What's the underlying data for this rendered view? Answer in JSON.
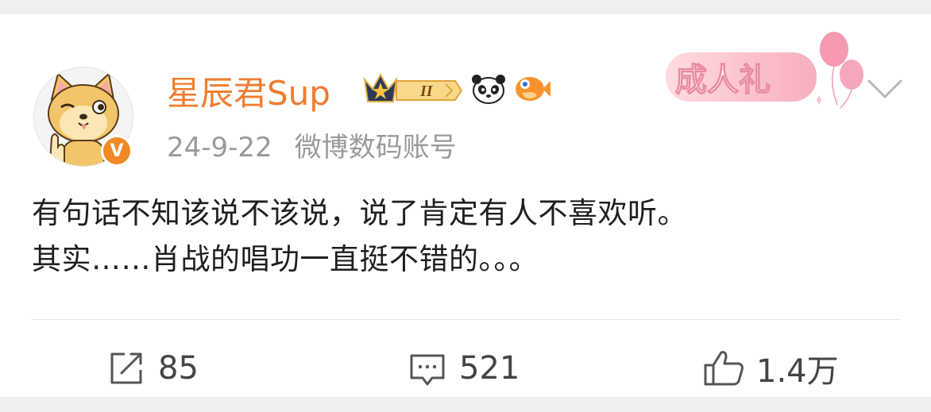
{
  "post": {
    "author": "星辰君Sup",
    "badge_level": "II",
    "date": "24-9-22",
    "account_type": "微博数码账号",
    "ceremony_badge": "成人礼",
    "text_lines": [
      "有句话不知该说不该说，说了肯定有人不喜欢听。",
      "其实……肖战的唱功一直挺不错的。。。"
    ]
  },
  "actions": {
    "reposts": "85",
    "comments": "521",
    "likes": "1.4万"
  },
  "colors": {
    "username": "#ef7d31",
    "meta": "#9a9a9a",
    "verified": "#f08a24",
    "background": "#efefef"
  }
}
